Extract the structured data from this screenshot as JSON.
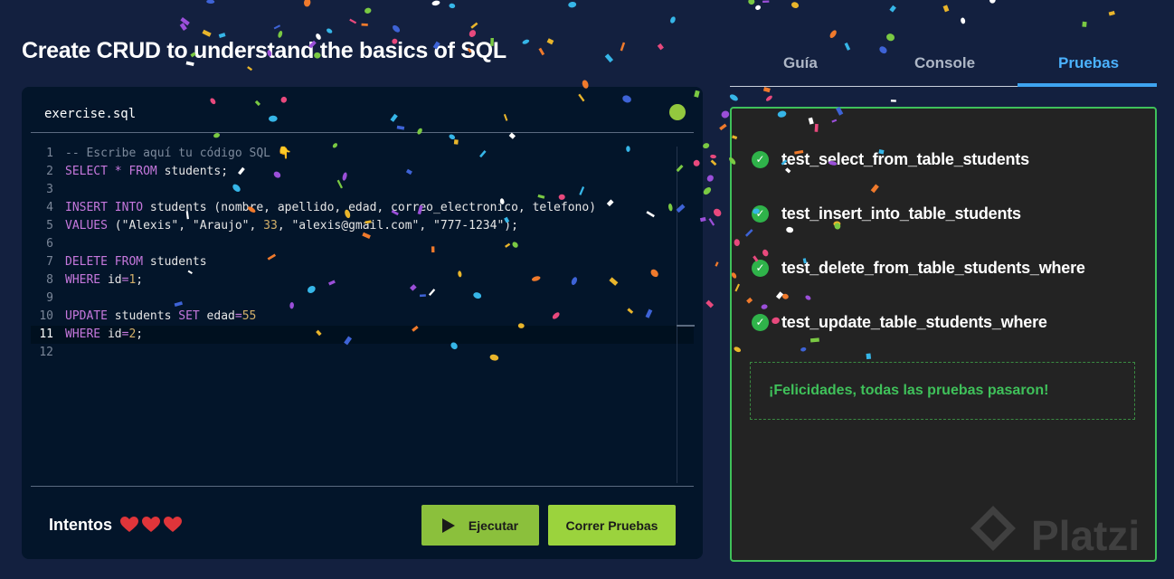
{
  "page": {
    "title": "Create CRUD to understand the basics of SQL"
  },
  "editor": {
    "filename": "exercise.sql",
    "lines": [
      {
        "n": "1",
        "tokens": [
          [
            "cm",
            "-- Escribe aquí tu código SQL 👇"
          ]
        ]
      },
      {
        "n": "2",
        "tokens": [
          [
            "kw",
            "SELECT"
          ],
          [
            "str",
            " "
          ],
          [
            "kw",
            "*"
          ],
          [
            "str",
            " "
          ],
          [
            "kw",
            "FROM"
          ],
          [
            "str",
            " students;"
          ]
        ]
      },
      {
        "n": "3",
        "tokens": []
      },
      {
        "n": "4",
        "tokens": [
          [
            "kw",
            "INSERT"
          ],
          [
            "str",
            " "
          ],
          [
            "kw",
            "INTO"
          ],
          [
            "str",
            " students (nombre, apellido, edad, correo_electronico, telefono)"
          ]
        ]
      },
      {
        "n": "5",
        "tokens": [
          [
            "kw",
            "VALUES"
          ],
          [
            "str",
            " (\"Alexis\", \"Araujo\", "
          ],
          [
            "num",
            "33"
          ],
          [
            "str",
            ", \"alexis@gmail.com\", \"777-1234\");"
          ]
        ]
      },
      {
        "n": "6",
        "tokens": []
      },
      {
        "n": "7",
        "tokens": [
          [
            "kw",
            "DELETE"
          ],
          [
            "str",
            " "
          ],
          [
            "kw",
            "FROM"
          ],
          [
            "str",
            " students"
          ]
        ]
      },
      {
        "n": "8",
        "tokens": [
          [
            "kw",
            "WHERE"
          ],
          [
            "str",
            " id"
          ],
          [
            "kw",
            "="
          ],
          [
            "num",
            "1"
          ],
          [
            "str",
            ";"
          ]
        ]
      },
      {
        "n": "9",
        "tokens": []
      },
      {
        "n": "10",
        "tokens": [
          [
            "kw",
            "UPDATE"
          ],
          [
            "str",
            " students "
          ],
          [
            "kw",
            "SET"
          ],
          [
            "str",
            " edad"
          ],
          [
            "kw",
            "="
          ],
          [
            "num",
            "55"
          ]
        ]
      },
      {
        "n": "11",
        "tokens": [
          [
            "kw",
            "WHERE"
          ],
          [
            "str",
            " id"
          ],
          [
            "kw",
            "="
          ],
          [
            "num",
            "2"
          ],
          [
            "str",
            ";"
          ]
        ],
        "active": true
      },
      {
        "n": "12",
        "tokens": []
      }
    ],
    "attempts_label": "Intentos",
    "hearts": 3,
    "run_label": "Ejecutar",
    "tests_label": "Correr Pruebas"
  },
  "tabs": [
    {
      "label": "Guía",
      "active": false
    },
    {
      "label": "Console",
      "active": false
    },
    {
      "label": "Pruebas",
      "active": true
    }
  ],
  "tests": {
    "items": [
      "test_select_from_table_students",
      "test_insert_into_table_students",
      "test_delete_from_table_students_where",
      "test_update_table_students_where"
    ],
    "success_message": "¡Felicidades, todas las pruebas pasaron!"
  },
  "watermark": {
    "brand": "Platzi"
  },
  "colors": {
    "background": "#13203f",
    "editor_bg": "#03152a",
    "accent_green": "#3fc15a",
    "button_green": "#8bc03c",
    "tab_active": "#4bb2ff",
    "heart": "#e0353a"
  }
}
